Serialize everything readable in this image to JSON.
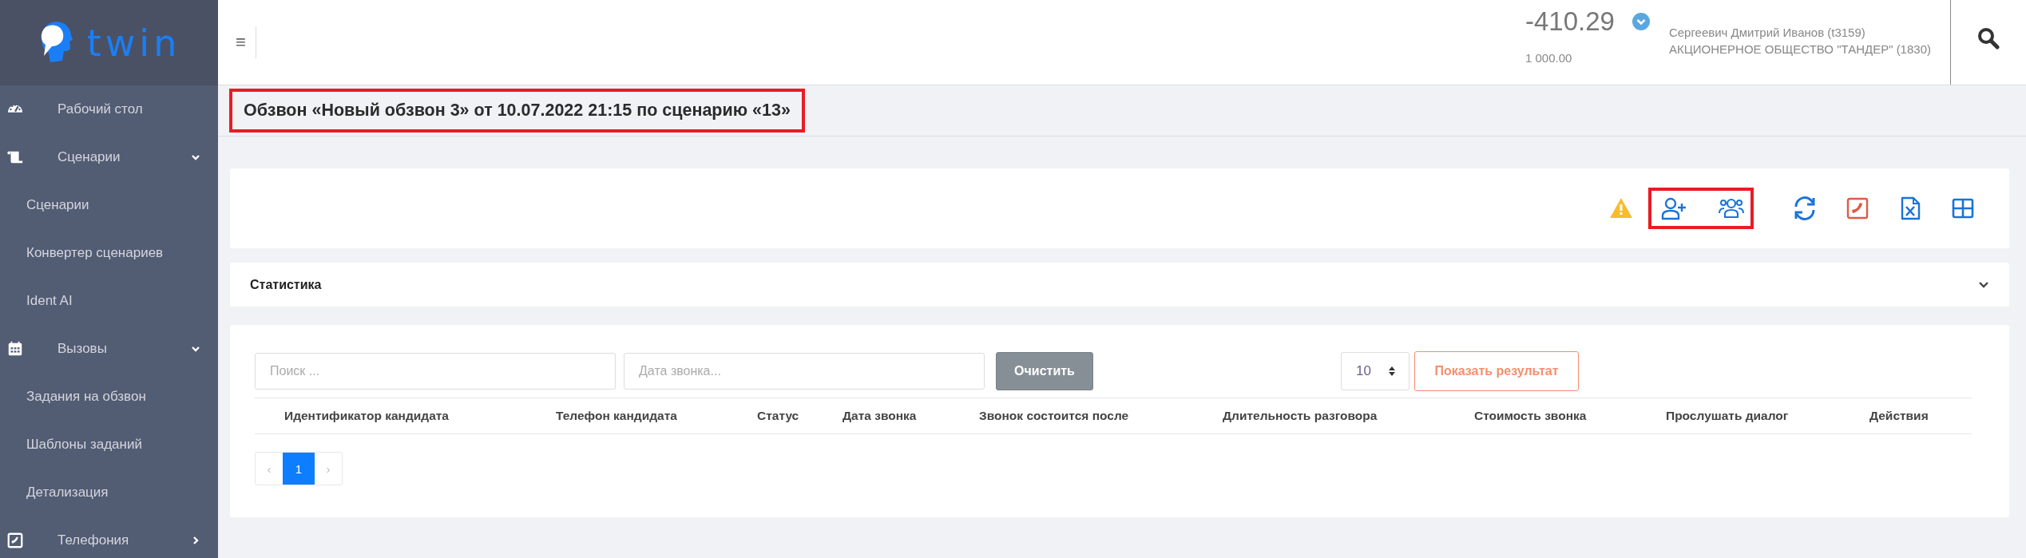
{
  "sidebar": {
    "logo_text": "twin",
    "items": [
      {
        "label": "Рабочий стол"
      },
      {
        "label": "Сценарии",
        "expanded": true,
        "children": [
          {
            "label": "Сценарии"
          },
          {
            "label": "Конвертер сценариев"
          },
          {
            "label": "Ident AI"
          }
        ]
      },
      {
        "label": "Вызовы",
        "expanded": true,
        "children": [
          {
            "label": "Задания на обзвон"
          },
          {
            "label": "Шаблоны заданий"
          },
          {
            "label": "Детализация"
          }
        ]
      },
      {
        "label": "Телефония",
        "expanded": false
      }
    ]
  },
  "header": {
    "menu_glyph": "≡",
    "balance": "-410.29",
    "credit": "1 000.00",
    "user": "Сергеевич Дмитрий Иванов (t3159)",
    "company": "АКЦИОНЕРНОЕ ОБЩЕСТВО \"ТАНДЕР\" (1830)"
  },
  "page_title": {
    "text": "Обзвон «Новый обзвон 3» от 10.07.2022 21:15 по сценарию «13»",
    "highlighted": true
  },
  "toolbar": {
    "groups": [
      {
        "icons": [
          {
            "kind": "warning"
          }
        ]
      },
      {
        "highlighted": true,
        "icons": [
          {
            "kind": "add-user"
          },
          {
            "kind": "users"
          }
        ]
      },
      {
        "icons": [
          {
            "kind": "refresh"
          },
          {
            "kind": "phone"
          },
          {
            "kind": "excel"
          },
          {
            "kind": "grid"
          }
        ]
      }
    ]
  },
  "statistics": {
    "title": "Статистика",
    "expanded": false
  },
  "filters": {
    "search_placeholder": "Поиск ...",
    "date_placeholder": "Дата звонка...",
    "clear_button": "Очистить",
    "page_size": "10",
    "show_button": "Показать результат"
  },
  "table": {
    "columns": [
      "Идентификатор кандидата",
      "Телефон кандидата",
      "Статус",
      "Дата звонка",
      "Звонок состоится после",
      "Длительность разговора",
      "Стоимость звонка",
      "Прослушать диалог",
      "Действия"
    ]
  },
  "pagination": {
    "prev": "‹",
    "pages": [
      {
        "label": "1",
        "selected": true
      }
    ],
    "next": "›"
  }
}
